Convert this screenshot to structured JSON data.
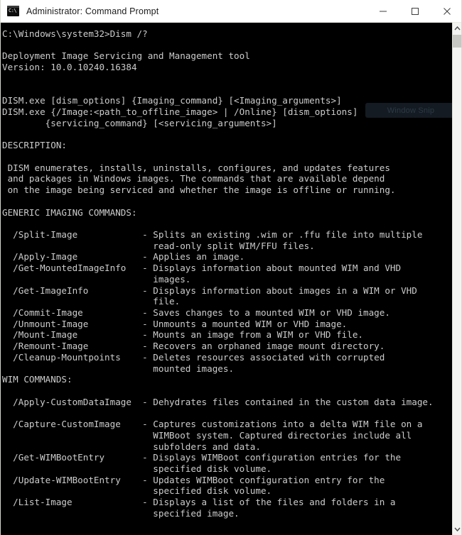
{
  "window": {
    "title": "Administrator: Command Prompt",
    "icon": "cmd-icon",
    "icon_prompt": "C:\\",
    "background_color": "#000000",
    "titlebar_color": "#ffffff",
    "text_color": "#cccccc"
  },
  "window_controls": {
    "minimize_label": "Minimize",
    "maximize_label": "Maximize",
    "close_label": "Close"
  },
  "watermark": {
    "label": "Window Snip"
  },
  "scrollbar": {
    "up_arrow": "scroll-up-icon",
    "down_arrow": "scroll-down-icon",
    "position": "top"
  },
  "console": {
    "prompt_path": "C:\\Windows\\system32>",
    "command": "Dism /?",
    "tool_name": "Deployment Image Servicing and Management tool",
    "version_label": "Version:",
    "version": "10.0.10240.16384",
    "usage_lines": [
      "DISM.exe [dism_options] {Imaging_command} [<Imaging_arguments>]",
      "DISM.exe {/Image:<path_to_offline_image> | /Online} [dism_options]",
      "        {servicing_command} [<servicing_arguments>]"
    ],
    "description_heading": "DESCRIPTION:",
    "description_lines": [
      " DISM enumerates, installs, uninstalls, configures, and updates features",
      " and packages in Windows images. The commands that are available depend",
      " on the image being serviced and whether the image is offline or running."
    ],
    "sections": [
      {
        "heading": "GENERIC IMAGING COMMANDS:",
        "entries": [
          {
            "command": "/Split-Image",
            "description": "Splits an existing .wim or .ffu file into multiple\nread-only split WIM/FFU files."
          },
          {
            "command": "/Apply-Image",
            "description": "Applies an image."
          },
          {
            "command": "/Get-MountedImageInfo",
            "description": "Displays information about mounted WIM and VHD\nimages."
          },
          {
            "command": "/Get-ImageInfo",
            "description": "Displays information about images in a WIM or VHD\nfile."
          },
          {
            "command": "/Commit-Image",
            "description": "Saves changes to a mounted WIM or VHD image."
          },
          {
            "command": "/Unmount-Image",
            "description": "Unmounts a mounted WIM or VHD image."
          },
          {
            "command": "/Mount-Image",
            "description": "Mounts an image from a WIM or VHD file."
          },
          {
            "command": "/Remount-Image",
            "description": "Recovers an orphaned image mount directory."
          },
          {
            "command": "/Cleanup-Mountpoints",
            "description": "Deletes resources associated with corrupted\nmounted images."
          }
        ]
      },
      {
        "heading": "WIM COMMANDS:",
        "entries": [
          {
            "command": "/Apply-CustomDataImage",
            "description": "Dehydrates files contained in the custom data image."
          },
          {
            "command": "/Capture-CustomImage",
            "description": "Captures customizations into a delta WIM file on a\nWIMBoot system. Captured directories include all\nsubfolders and data."
          },
          {
            "command": "/Get-WIMBootEntry",
            "description": "Displays WIMBoot configuration entries for the\nspecified disk volume."
          },
          {
            "command": "/Update-WIMBootEntry",
            "description": "Updates WIMBoot configuration entry for the\nspecified disk volume."
          },
          {
            "command": "/List-Image",
            "description": "Displays a list of the files and folders in a\nspecified image."
          }
        ]
      }
    ],
    "full_text": "C:\\Windows\\system32>Dism /?\n\nDeployment Image Servicing and Management tool\nVersion: 10.0.10240.16384\n\n\nDISM.exe [dism_options] {Imaging_command} [<Imaging_arguments>]\nDISM.exe {/Image:<path_to_offline_image> | /Online} [dism_options]\n        {servicing_command} [<servicing_arguments>]\n\nDESCRIPTION:\n\n DISM enumerates, installs, uninstalls, configures, and updates features\n and packages in Windows images. The commands that are available depend\n on the image being serviced and whether the image is offline or running.\n\nGENERIC IMAGING COMMANDS:\n\n  /Split-Image            - Splits an existing .wim or .ffu file into multiple\n                            read-only split WIM/FFU files.\n  /Apply-Image            - Applies an image.\n  /Get-MountedImageInfo   - Displays information about mounted WIM and VHD\n                            images.\n  /Get-ImageInfo          - Displays information about images in a WIM or VHD\n                            file.\n  /Commit-Image           - Saves changes to a mounted WIM or VHD image.\n  /Unmount-Image          - Unmounts a mounted WIM or VHD image.\n  /Mount-Image            - Mounts an image from a WIM or VHD file.\n  /Remount-Image          - Recovers an orphaned image mount directory.\n  /Cleanup-Mountpoints    - Deletes resources associated with corrupted\n                            mounted images.\nWIM COMMANDS:\n\n  /Apply-CustomDataImage  - Dehydrates files contained in the custom data image.\n\n  /Capture-CustomImage    - Captures customizations into a delta WIM file on a\n                            WIMBoot system. Captured directories include all\n                            subfolders and data.\n  /Get-WIMBootEntry       - Displays WIMBoot configuration entries for the\n                            specified disk volume.\n  /Update-WIMBootEntry    - Updates WIMBoot configuration entry for the\n                            specified disk volume.\n  /List-Image             - Displays a list of the files and folders in a\n                            specified image."
  }
}
